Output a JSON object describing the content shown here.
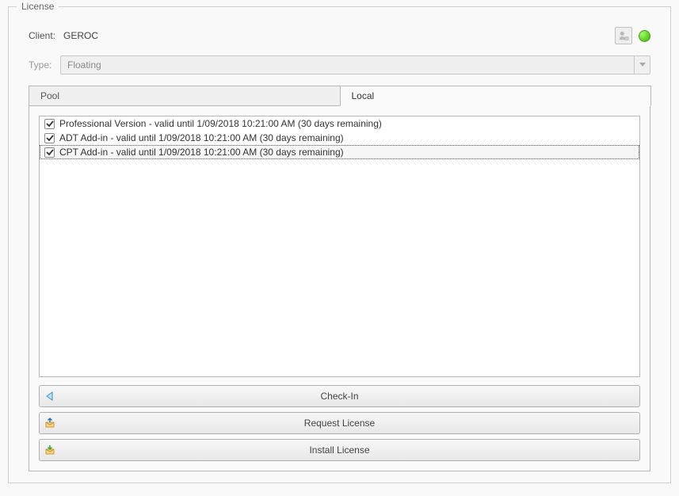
{
  "groupbox": {
    "title": "License"
  },
  "client": {
    "label": "Client:",
    "value": "GEROC"
  },
  "type": {
    "label": "Type:",
    "value": "Floating"
  },
  "tabs": [
    {
      "label": "Pool"
    },
    {
      "label": "Local"
    }
  ],
  "licenses": [
    {
      "checked": true,
      "selected": false,
      "text": "Professional Version - valid until 1/09/2018 10:21:00 AM (30 days remaining)"
    },
    {
      "checked": true,
      "selected": false,
      "text": "ADT Add-in - valid until 1/09/2018 10:21:00 AM (30 days remaining)"
    },
    {
      "checked": true,
      "selected": true,
      "text": "CPT Add-in - valid until 1/09/2018 10:21:00 AM (30 days remaining)"
    }
  ],
  "buttons": {
    "checkin": "Check-In",
    "request": "Request License",
    "install": "Install License"
  }
}
